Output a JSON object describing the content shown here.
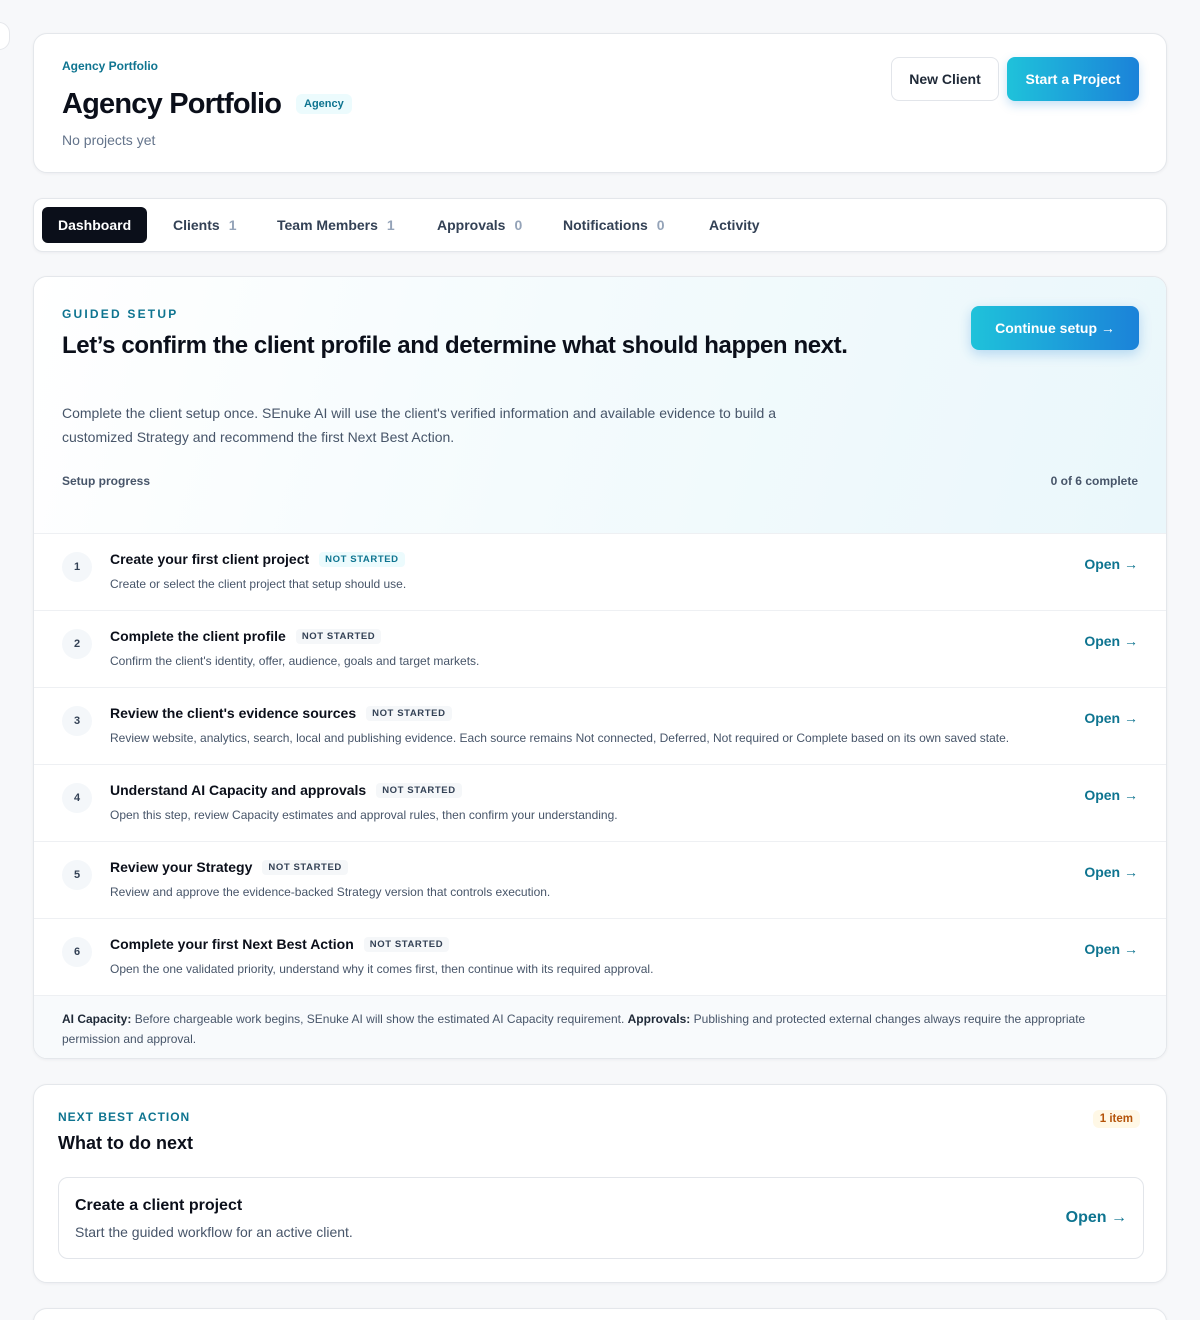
{
  "header": {
    "eyebrow": "Agency Portfolio",
    "title": "Agency Portfolio",
    "badge": "Agency",
    "subtitle": "No projects yet",
    "new_client_label": "New Client",
    "start_project_label": "Start a Project"
  },
  "tabs": [
    {
      "label": "Dashboard",
      "count": null,
      "active": true
    },
    {
      "label": "Clients",
      "count": "1"
    },
    {
      "label": "Team Members",
      "count": "1"
    },
    {
      "label": "Approvals",
      "count": "0"
    },
    {
      "label": "Notifications",
      "count": "0"
    },
    {
      "label": "Activity",
      "count": null
    }
  ],
  "guided_setup": {
    "eyebrow": "GUIDED SETUP",
    "title": "Let’s confirm the client profile and determine what should happen next.",
    "description": "Complete the client setup once. SEnuke AI will use the client's verified information and available evidence to build a customized Strategy and recommend the first Next Best Action.",
    "continue_label": "Continue setup →",
    "progress_label": "Setup progress",
    "progress_value": "0 of 6 complete",
    "progress_fraction": 0,
    "steps": [
      {
        "num": "1",
        "title": "Create your first client project",
        "status": "NOT STARTED",
        "desc": "Create or select the client project that setup should use.",
        "action": "Open →"
      },
      {
        "num": "2",
        "title": "Complete the client profile",
        "status": "NOT STARTED",
        "desc": "Confirm the client's identity, offer, audience, goals and target markets.",
        "action": "Open →"
      },
      {
        "num": "3",
        "title": "Review the client's evidence sources",
        "status": "NOT STARTED",
        "desc": "Review website, analytics, search, local and publishing evidence. Each source remains Not connected, Deferred, Not required or Complete based on its own saved state.",
        "action": "Open →"
      },
      {
        "num": "4",
        "title": "Understand AI Capacity and approvals",
        "status": "NOT STARTED",
        "desc": "Open this step, review Capacity estimates and approval rules, then confirm your understanding.",
        "action": "Open →"
      },
      {
        "num": "5",
        "title": "Review your Strategy",
        "status": "NOT STARTED",
        "desc": "Review and approve the evidence-backed Strategy version that controls execution.",
        "action": "Open →"
      },
      {
        "num": "6",
        "title": "Complete your first Next Best Action",
        "status": "NOT STARTED",
        "desc": "Open the one validated priority, understand why it comes first, then continue with its required approval.",
        "action": "Open →"
      }
    ],
    "note": {
      "capacity_label": "AI Capacity:",
      "capacity_text": " Before chargeable work begins, SEnuke AI will show the estimated AI Capacity requirement. ",
      "approvals_label": "Approvals:",
      "approvals_text": " Publishing and protected external changes always require the appropriate permission and approval."
    }
  },
  "next_best_action": {
    "eyebrow": "NEXT BEST ACTION",
    "title": "What to do next",
    "count": "1 item",
    "item": {
      "title": "Create a client project",
      "desc": "Start the guided workflow for an active client.",
      "action": "Open →"
    }
  },
  "colors": {
    "accent": "#0e7490",
    "primary_gradient_start": "#1fc2da",
    "primary_gradient_end": "#1b82d9",
    "dark": "#0b0f1a"
  }
}
